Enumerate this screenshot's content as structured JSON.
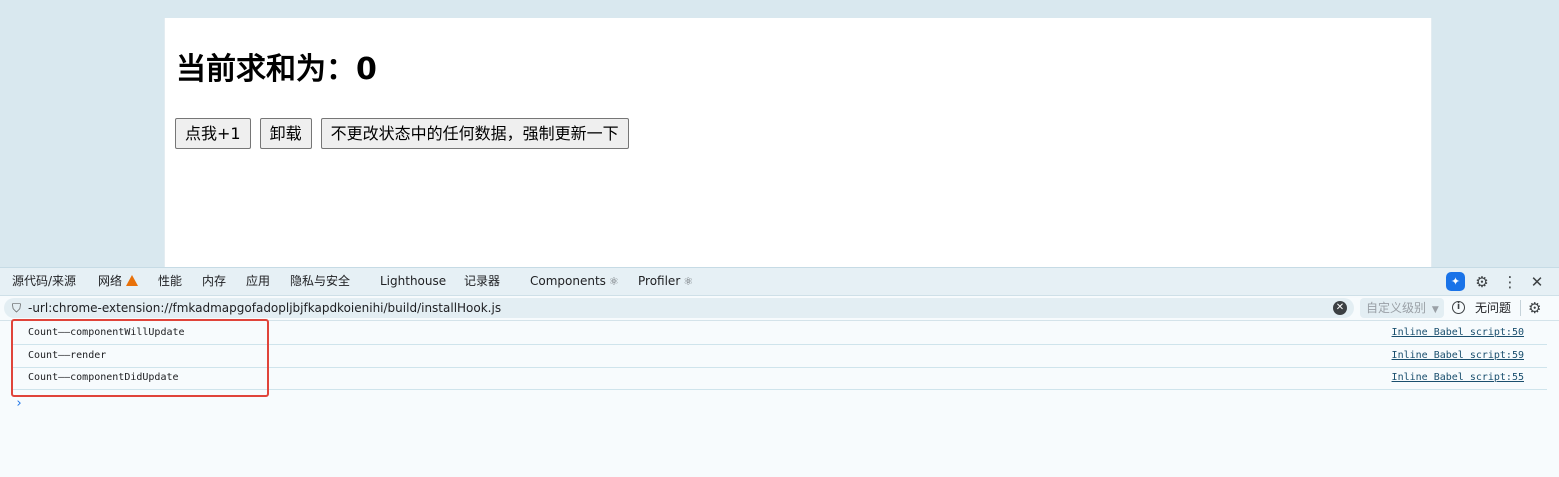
{
  "page": {
    "heading": "当前求和为：0",
    "buttons": {
      "increment": "点我+1",
      "unmount": "卸载",
      "force_update": "不更改状态中的任何数据，强制更新一下"
    }
  },
  "devtools": {
    "tabs": [
      "源代码/来源",
      "网络",
      "性能",
      "内存",
      "应用",
      "隐私与安全",
      "Lighthouse",
      "记录器",
      "Components",
      "Profiler"
    ],
    "filter": {
      "value": "-url:chrome-extension://fmkadmapgofadopljbjfkapdkoienihi/build/installHook.js",
      "level_label": "自定义级别",
      "issues_label": "无问题"
    },
    "console": {
      "logs": [
        {
          "message": "Count——componentWillUpdate",
          "source": "Inline Babel script:50"
        },
        {
          "message": "Count——render",
          "source": "Inline Babel script:59"
        },
        {
          "message": "Count——componentDidUpdate",
          "source": "Inline Babel script:55"
        }
      ]
    }
  },
  "colors": {
    "accent": "#1a73e8",
    "warning": "#e8710a",
    "highlight": "#e0443a"
  }
}
